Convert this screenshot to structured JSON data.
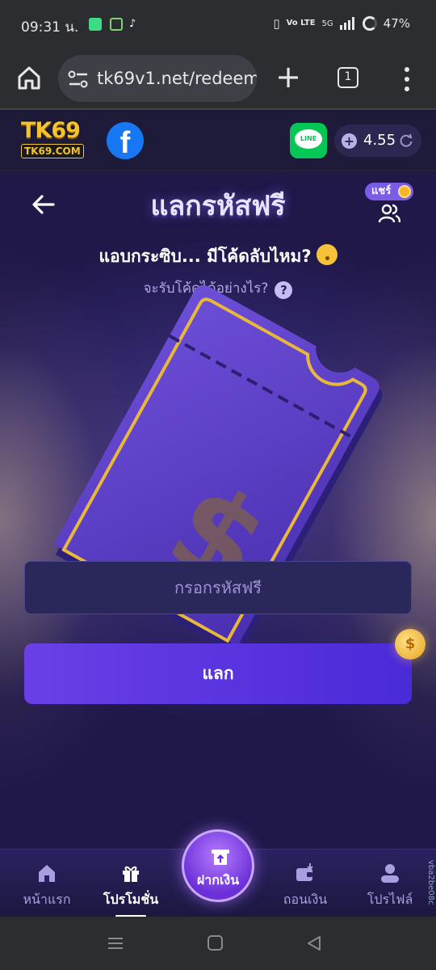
{
  "status_bar": {
    "time": "09:31",
    "suffix": "น.",
    "network": "Vo LTE",
    "signal_label": "5G",
    "battery": "47%"
  },
  "browser": {
    "url": "tk69v1.net/redeem",
    "tab_count": "1"
  },
  "site_header": {
    "logo_top": "TK69",
    "logo_bottom": "TK69.COM",
    "facebook_letter": "f",
    "line_label": "LINE",
    "balance": "4.55",
    "balance_plus": "+"
  },
  "page": {
    "title": "แลกรหัสฟรี",
    "share_badge": "แชร์",
    "hint": "แอบกระซิบ... มีโค้ดลับไหม?",
    "how_to": "จะรับโค้ดได้อย่างไร?",
    "help": "?",
    "input_placeholder": "กรอกรหัสฟรี",
    "redeem_button": "แลก",
    "coin_symbol": "$"
  },
  "bottom_nav": {
    "items": [
      {
        "label": "หน้าแรก",
        "icon": "home-icon"
      },
      {
        "label": "โปรโมชั่น",
        "icon": "gift-icon",
        "active": true
      },
      {
        "label": "ฝากเงิน",
        "icon": "deposit-icon"
      },
      {
        "label": "ถอนเงิน",
        "icon": "wallet-icon"
      },
      {
        "label": "โปรไฟล์",
        "icon": "profile-icon"
      }
    ]
  },
  "side_text": "vba2be08c",
  "colors": {
    "accent": "#5b34e0",
    "background": "#1f1848",
    "gold": "#f4c430"
  }
}
